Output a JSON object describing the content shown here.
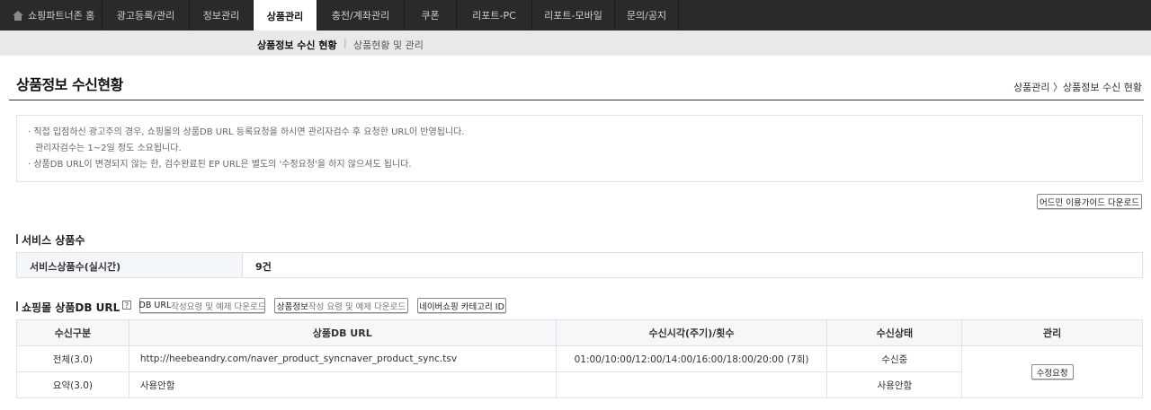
{
  "top_nav": {
    "home": "쇼핑파트너존 홈",
    "tabs": [
      "광고등록/관리",
      "정보관리",
      "상품관리",
      "충전/계좌관리",
      "쿠폰",
      "리포트-PC",
      "리포트-모바일",
      "문의/공지"
    ],
    "active_tab": "상품관리"
  },
  "sub_nav": {
    "items": [
      "상품정보 수신 현황",
      "상품현황 및 관리"
    ],
    "separator": "|"
  },
  "page": {
    "title": "상품정보 수신현황",
    "breadcrumb": "상품관리 〉상품정보 수신 현황"
  },
  "notice": {
    "line1": "· 직접 입점하신 광고주의 경우, 쇼핑몰의 상품DB URL 등록요청을 하시면 관리자검수 후 요청한 URL이 반영됩니다.",
    "line2": "관리자검수는 1~2일 정도 소요됩니다.",
    "line3": "· 상품DB URL이 변경되지 않는 한, 검수완료된 EP URL은 별도의 '수정요청'을 하지 않으셔도 됩니다."
  },
  "guide_button": "어드민 이용가이드 다운로드",
  "service_section": {
    "title": "서비스 상품수",
    "label": "서비스상품수(실시간)",
    "value": "9건"
  },
  "db_section": {
    "title": "쇼핑몰 상품DB URL",
    "help": "?",
    "buttons": [
      {
        "strong": "DB URL",
        "light": " 작성요령 및 예제 다운로드"
      },
      {
        "strong": "상품정보",
        "light": " 작성 요령 및 예제 다운로드"
      },
      {
        "strong": "네이버쇼핑 카테고리 ID",
        "light": ""
      }
    ]
  },
  "table": {
    "headers": [
      "수신구분",
      "상품DB URL",
      "수신시각(주기)/횟수",
      "수신상태",
      "관리"
    ],
    "rows": [
      {
        "type": "전체(3.0)",
        "url": "http://heebeandry.com/naver_product_syncnaver_product_sync.tsv",
        "schedule": "01:00/10:00/12:00/14:00/16:00/18:00/20:00 (7회)",
        "status": "수신중"
      },
      {
        "type": "요약(3.0)",
        "url": "사용안함",
        "schedule": "",
        "status": "사용안함"
      }
    ],
    "action_button": "수정요청"
  }
}
